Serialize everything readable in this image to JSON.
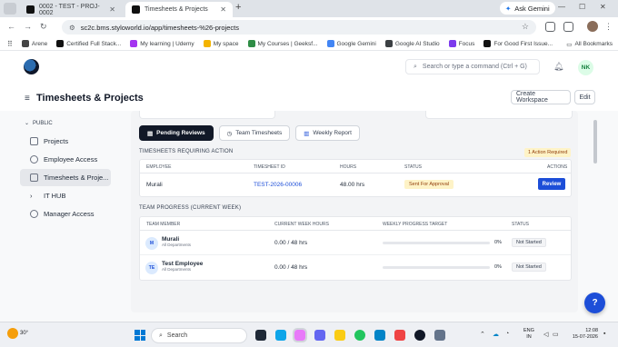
{
  "browser": {
    "tabs": [
      {
        "title": "0002 - TEST - PROJ-0002",
        "active": false
      },
      {
        "title": "Timesheets & Projects",
        "active": true
      }
    ],
    "new_tab": "+",
    "ask_gemini": "Ask Gemini",
    "url": "sc2c.bms.styloworld.io/app/timesheets-%26-projects",
    "bookmarks": [
      {
        "label": "Arene",
        "color": "#444444"
      },
      {
        "label": "Certified Full Stack...",
        "color": "#111111"
      },
      {
        "label": "My learning | Udemy",
        "color": "#a435f0"
      },
      {
        "label": "My space",
        "color": "#f4b400"
      },
      {
        "label": "My Courses | Geeksf...",
        "color": "#2f8d46"
      },
      {
        "label": "Google Gemini",
        "color": "#4285f4"
      },
      {
        "label": "Google AI Studio",
        "color": "#3c4043"
      },
      {
        "label": "Focus",
        "color": "#7c3aed"
      },
      {
        "label": "For Good First Issue...",
        "color": "#111111"
      }
    ],
    "all_bookmarks": "All Bookmarks"
  },
  "app": {
    "search_placeholder": "Search or type a command (Ctrl + G)",
    "user_initials": "NK",
    "page_title": "Timesheets & Projects",
    "create_workspace": "Create Workspace",
    "edit": "Edit",
    "help": "?"
  },
  "sidebar": {
    "section": "PUBLIC",
    "items": [
      {
        "label": "Projects",
        "icon": "folder-icon"
      },
      {
        "label": "Employee Access",
        "icon": "user-circle-icon"
      },
      {
        "label": "Timesheets & Proje...",
        "icon": "table-icon",
        "active": true
      },
      {
        "label": "IT HUB",
        "icon": "chevron-right-icon"
      },
      {
        "label": "Manager Access",
        "icon": "user-circle-icon"
      }
    ]
  },
  "view_tabs": [
    {
      "label": "Pending Reviews",
      "icon": "clipboard-icon",
      "selected": true
    },
    {
      "label": "Team Timesheets",
      "icon": "clock-icon",
      "selected": false
    },
    {
      "label": "Weekly Report",
      "icon": "chart-icon",
      "selected": false
    }
  ],
  "requiring_action": {
    "title": "TIMESHEETS REQUIRING ACTION",
    "badge": "1 Action Required",
    "columns": [
      "EMPLOYEE",
      "TIMESHEET ID",
      "HOURS",
      "STATUS",
      "ACTIONS"
    ],
    "rows": [
      {
        "employee": "Murali",
        "timesheet_id": "TEST-2026-00006",
        "hours": "48.00 hrs",
        "status": "Sent For Approval",
        "action": "Review"
      }
    ]
  },
  "team_progress": {
    "title": "TEAM PROGRESS (CURRENT WEEK)",
    "columns": [
      "TEAM MEMBER",
      "CURRENT WEEK HOURS",
      "WEEKLY PROGRESS TARGET",
      "STATUS"
    ],
    "rows": [
      {
        "initials": "M",
        "name": "Murali",
        "dept": "All Departments",
        "hours": "0.00 / 48 hrs",
        "progress": 0,
        "progress_label": "0%",
        "status": "Not Started"
      },
      {
        "initials": "TE",
        "name": "Test Employee",
        "dept": "All Departments",
        "hours": "0.00 / 48 hrs",
        "progress": 0,
        "progress_label": "0%",
        "status": "Not Started"
      }
    ]
  },
  "taskbar": {
    "weather": "30°",
    "search": "Search",
    "lang_line1": "ENG",
    "lang_line2": "IN",
    "time": "12:08",
    "date": "15-07-2026"
  }
}
